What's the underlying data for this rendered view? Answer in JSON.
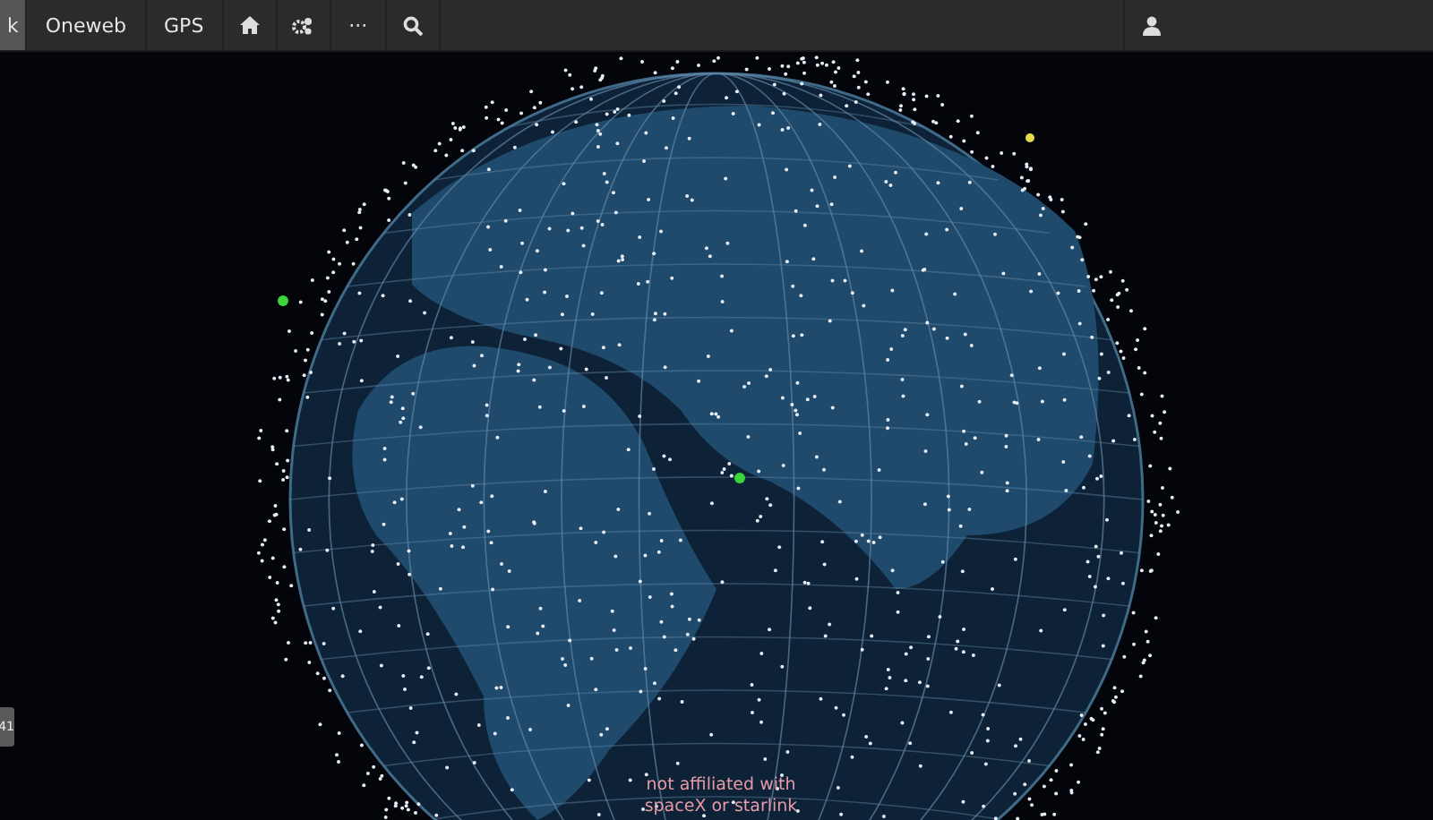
{
  "nav": {
    "items": [
      {
        "kind": "text",
        "label": "k",
        "selected": true
      },
      {
        "kind": "text",
        "label": "Oneweb",
        "selected": false
      },
      {
        "kind": "text",
        "label": "GPS",
        "selected": false
      },
      {
        "kind": "home",
        "selected": false
      },
      {
        "kind": "gears",
        "selected": false
      },
      {
        "kind": "text",
        "label": "···",
        "selected": false
      },
      {
        "kind": "search",
        "selected": false
      }
    ],
    "right_items": [
      {
        "kind": "user",
        "selected": false
      }
    ]
  },
  "side_tab": {
    "label": "41"
  },
  "disclaimer": "not affiliated with spaceX or starlink"
}
